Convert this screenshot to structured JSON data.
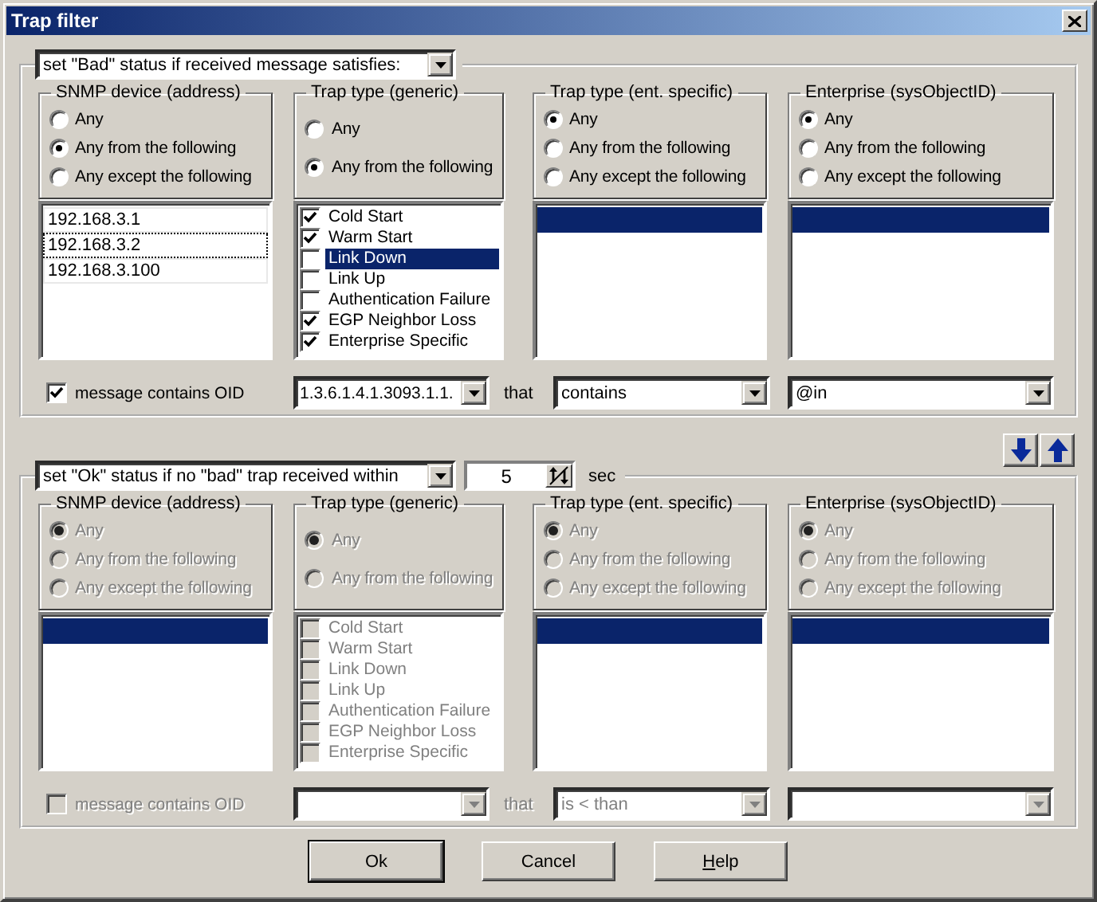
{
  "window": {
    "title": "Trap filter"
  },
  "sections": [
    {
      "condition": {
        "value": "set \"Bad\" status if received message satisfies:"
      },
      "groups": [
        {
          "kind": "radio_list",
          "title": "SNMP device (address)",
          "disabled": false,
          "options": [
            {
              "label": "Any",
              "selected": false
            },
            {
              "label": "Any from the following",
              "selected": true
            },
            {
              "label": "Any except the following",
              "selected": false
            }
          ],
          "list": {
            "items": [
              {
                "text": "192.168.3.1",
                "focused": false
              },
              {
                "text": "192.168.3.2",
                "focused": true
              },
              {
                "text": "192.168.3.100",
                "focused": false
              }
            ]
          }
        },
        {
          "kind": "check_list",
          "title": "Trap type (generic)",
          "disabled": false,
          "options": [
            {
              "label": "Any",
              "selected": false
            },
            {
              "label": "Any from the following",
              "selected": true
            }
          ],
          "list": {
            "items": [
              {
                "text": "Cold Start",
                "checked": true,
                "selected": false
              },
              {
                "text": "Warm Start",
                "checked": true,
                "selected": false
              },
              {
                "text": "Link Down",
                "checked": false,
                "selected": true
              },
              {
                "text": "Link Up",
                "checked": false,
                "selected": false
              },
              {
                "text": "Authentication Failure",
                "checked": false,
                "selected": false
              },
              {
                "text": "EGP Neighbor Loss",
                "checked": true,
                "selected": false
              },
              {
                "text": "Enterprise Specific",
                "checked": true,
                "selected": false
              }
            ]
          }
        },
        {
          "kind": "radio_list",
          "title": "Trap type (ent. specific)",
          "disabled": false,
          "options": [
            {
              "label": "Any",
              "selected": true
            },
            {
              "label": "Any from the following",
              "selected": false
            },
            {
              "label": "Any except the following",
              "selected": false
            }
          ],
          "list": {
            "highlight_row": true
          }
        },
        {
          "kind": "radio_list",
          "title": "Enterprise (sysObjectID)",
          "disabled": false,
          "options": [
            {
              "label": "Any",
              "selected": true
            },
            {
              "label": "Any from the following",
              "selected": false
            },
            {
              "label": "Any except the following",
              "selected": false
            }
          ],
          "list": {
            "highlight_row": true
          }
        }
      ],
      "oid_filter": {
        "disabled": false,
        "checked": true,
        "label": "message contains OID",
        "oid": "1.3.6.1.4.1.3093.1.1.",
        "conjunction": "that",
        "operator": "contains",
        "value": "@in"
      }
    },
    {
      "condition": {
        "value": "set \"Ok\" status if no \"bad\" trap received within"
      },
      "timeout": {
        "value": "5",
        "unit": "sec"
      },
      "groups": [
        {
          "kind": "radio_list",
          "title": "SNMP device (address)",
          "disabled": true,
          "options": [
            {
              "label": "Any",
              "selected": true
            },
            {
              "label": "Any from the following",
              "selected": false
            },
            {
              "label": "Any except the following",
              "selected": false
            }
          ],
          "list": {
            "highlight_row": true
          }
        },
        {
          "kind": "check_list",
          "title": "Trap type (generic)",
          "disabled": true,
          "options": [
            {
              "label": "Any",
              "selected": true
            },
            {
              "label": "Any from the following",
              "selected": false
            }
          ],
          "list": {
            "items": [
              {
                "text": "Cold Start",
                "checked": false,
                "selected": false
              },
              {
                "text": "Warm Start",
                "checked": false,
                "selected": false
              },
              {
                "text": "Link Down",
                "checked": false,
                "selected": false
              },
              {
                "text": "Link Up",
                "checked": false,
                "selected": false
              },
              {
                "text": "Authentication Failure",
                "checked": false,
                "selected": false
              },
              {
                "text": "EGP Neighbor Loss",
                "checked": false,
                "selected": false
              },
              {
                "text": "Enterprise Specific",
                "checked": false,
                "selected": false
              }
            ]
          }
        },
        {
          "kind": "radio_list",
          "title": "Trap type (ent. specific)",
          "disabled": true,
          "options": [
            {
              "label": "Any",
              "selected": true
            },
            {
              "label": "Any from the following",
              "selected": false
            },
            {
              "label": "Any except the following",
              "selected": false
            }
          ],
          "list": {
            "highlight_row": true
          }
        },
        {
          "kind": "radio_list",
          "title": "Enterprise (sysObjectID)",
          "disabled": true,
          "options": [
            {
              "label": "Any",
              "selected": true
            },
            {
              "label": "Any from the following",
              "selected": false
            },
            {
              "label": "Any except the following",
              "selected": false
            }
          ],
          "list": {
            "highlight_row": true
          }
        }
      ],
      "oid_filter": {
        "disabled": true,
        "checked": false,
        "label": "message contains OID",
        "conjunction": "that",
        "operator": "is < than"
      }
    }
  ],
  "order_buttons": [
    {
      "kind": "down"
    },
    {
      "kind": "up"
    }
  ],
  "buttons": [
    {
      "label": "Ok",
      "default": true,
      "mnemonic": false
    },
    {
      "label": "Cancel",
      "default": false,
      "mnemonic": false
    },
    {
      "label": "Help",
      "default": false,
      "mnemonic": true
    }
  ]
}
